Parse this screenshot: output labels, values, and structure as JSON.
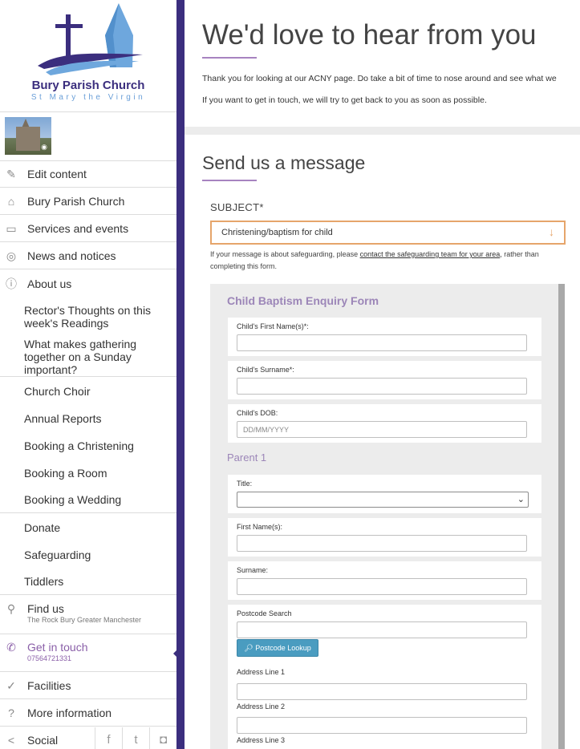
{
  "brand": {
    "title": "Bury Parish Church",
    "subtitle": "St Mary the Virgin",
    "primary_color": "#3b2e7e",
    "accent_color": "#a783c0"
  },
  "sidebar": {
    "items": [
      {
        "label": "Edit content",
        "icon": "pencil-icon"
      },
      {
        "label": "Bury Parish Church",
        "icon": "home-icon"
      },
      {
        "label": "Services and events",
        "icon": "calendar-icon"
      },
      {
        "label": "News and notices",
        "icon": "broadcast-icon"
      },
      {
        "label": "About us",
        "icon": "info-icon"
      }
    ],
    "about_subitems": [
      "Rector's Thoughts on this week's Readings",
      "What makes gathering together on a Sunday important?",
      "Church Choir",
      "Annual Reports",
      "Booking a Christening",
      "Booking a Room",
      "Booking a Wedding",
      "Donate",
      "Safeguarding",
      "Tiddlers"
    ],
    "find_us": {
      "label": "Find us",
      "detail": "The Rock Bury Greater Manchester",
      "icon": "location-pin-icon"
    },
    "get_in_touch": {
      "label": "Get in touch",
      "detail": "07564721331",
      "icon": "phone-icon"
    },
    "facilities": {
      "label": "Facilities",
      "icon": "check-circle-icon"
    },
    "more_info": {
      "label": "More information",
      "icon": "question-circle-icon"
    },
    "social": {
      "label": "Social",
      "icon": "share-icon",
      "links": [
        "facebook-icon",
        "twitter-icon",
        "instagram-icon"
      ]
    }
  },
  "hero": {
    "title": "We'd love to hear from you",
    "line1": "Thank you for looking at our ACNY page. Do take a bit of time to nose around and see what we",
    "line2": "If you want to get in touch, we will try to get back to you as soon as possible."
  },
  "message": {
    "title": "Send us a message",
    "subject_label": "SUBJECT*",
    "subject_value": "Christening/baptism for child",
    "note_before": "If your message is about safeguarding, please ",
    "note_link": "contact the safeguarding team for your area",
    "note_after": ", rather than completing this form."
  },
  "form": {
    "title": "Child Baptism Enquiry Form",
    "child_first_name_label": "Child's First Name(s)*:",
    "child_surname_label": "Child's Surname*:",
    "child_dob_label": "Child's DOB:",
    "child_dob_placeholder": "DD/MM/YYYY",
    "parent_heading": "Parent 1",
    "title_label": "Title:",
    "first_names_label": "First Name(s):",
    "surname_label": "Surname:",
    "postcode_label": "Postcode Search",
    "postcode_button": "Postcode Lookup",
    "address1_label": "Address Line 1",
    "address2_label": "Address Line 2",
    "address3_label": "Address Line 3"
  }
}
